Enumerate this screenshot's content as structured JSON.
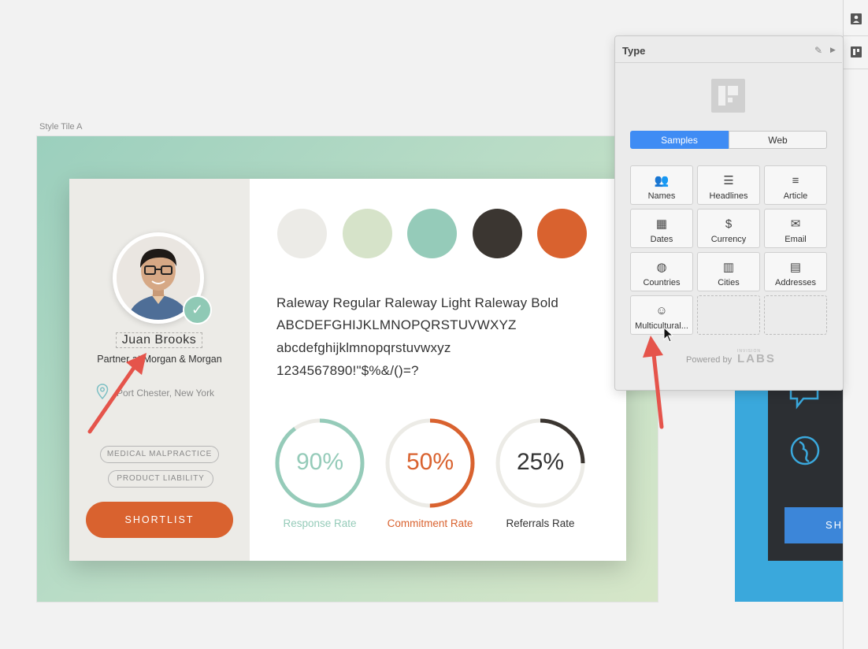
{
  "artboard": {
    "label": "Style Tile A"
  },
  "profile": {
    "name": "Juan Brooks",
    "subtitle": "Partner at Morgan & Morgan",
    "location": "Port Chester, New York",
    "tags": [
      "MEDICAL MALPRACTICE",
      "PRODUCT LIABILITY"
    ],
    "button": "SHORTLIST"
  },
  "palette": [
    "#ecebe7",
    "#d6e3c9",
    "#95cbb9",
    "#3b3631",
    "#d9622f"
  ],
  "typography": {
    "line1": "Raleway Regular Raleway Light Raleway Bold",
    "line2": "ABCDEFGHIJKLMNOPQRSTUVWXYZ",
    "line3": "abcdefghijklmnopqrstuvwxyz",
    "line4": "1234567890!\"$%&/()=?"
  },
  "stats": [
    {
      "value": "90%",
      "label": "Response Rate",
      "fraction": 0.9,
      "color": "#95cbb9",
      "text_color": "#95cbb9"
    },
    {
      "value": "50%",
      "label": "Commitment Rate",
      "fraction": 0.5,
      "color": "#d9622f",
      "text_color": "#d9622f"
    },
    {
      "value": "25%",
      "label": "Referrals Rate",
      "fraction": 0.25,
      "color": "#3b3631",
      "text_color": "#333333"
    }
  ],
  "artboard_b": {
    "button_partial": "SH"
  },
  "panel": {
    "title": "Type",
    "tabs": [
      "Samples",
      "Web"
    ],
    "active_tab": "Samples",
    "tiles": [
      {
        "label": "Names",
        "icon": "people-icon"
      },
      {
        "label": "Headlines",
        "icon": "headline-icon"
      },
      {
        "label": "Article",
        "icon": "article-icon"
      },
      {
        "label": "Dates",
        "icon": "calendar-icon"
      },
      {
        "label": "Currency",
        "icon": "currency-icon"
      },
      {
        "label": "Email",
        "icon": "envelope-icon"
      },
      {
        "label": "Countries",
        "icon": "globe-icon"
      },
      {
        "label": "Cities",
        "icon": "building-icon"
      },
      {
        "label": "Addresses",
        "icon": "address-card-icon"
      },
      {
        "label": "Multicultural...",
        "icon": "smiley-icon"
      }
    ],
    "powered_by": "Powered by",
    "brand_small": "INVISION",
    "brand": "LABS"
  }
}
